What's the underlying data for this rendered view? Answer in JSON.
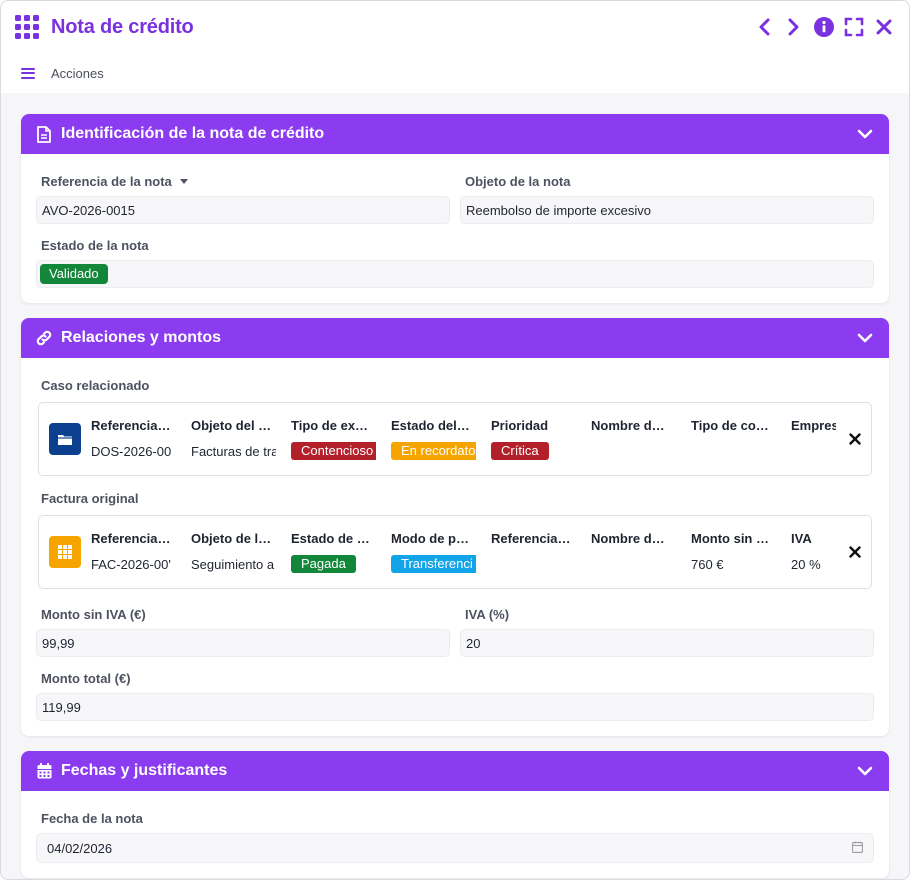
{
  "window": {
    "title": "Nota de crédito"
  },
  "actions": {
    "label": "Acciones"
  },
  "colors": {
    "accent": "#7a32e0",
    "header": "#8b3cf0",
    "green": "#12873a",
    "red": "#b4202a",
    "orange": "#f5a400",
    "blue": "#12a4e8",
    "navy": "#0d3f8f"
  },
  "section1": {
    "title": "Identificación de la nota de crédito",
    "ref_label": "Referencia de la nota",
    "ref_value": "AVO-2026-0015",
    "obj_label": "Objeto de la nota",
    "obj_value": "Reembolso de importe excesivo",
    "status_label": "Estado de la nota",
    "status_value": "Validado"
  },
  "section2": {
    "title": "Relaciones y montos",
    "case_label": "Caso relacionado",
    "case_headers": [
      "Referencia…",
      "Objeto del …",
      "Tipo de ex…",
      "Estado del…",
      "Prioridad",
      "Nombre d…",
      "Tipo de co…",
      "Empres"
    ],
    "case_values": [
      "DOS-2026-00",
      "Facturas de tra",
      "Contencioso",
      "En recordato",
      "Crítica",
      "",
      "",
      ""
    ],
    "invoice_label": "Factura original",
    "invoice_headers": [
      "Referencia…",
      "Objeto de l…",
      "Estado de …",
      "Modo de p…",
      "Referencia…",
      "Nombre d…",
      "Monto sin …",
      "IVA"
    ],
    "invoice_values": [
      "FAC-2026-00'",
      "Seguimiento a",
      "Pagada",
      "Transferenci",
      "",
      "",
      "760 €",
      "20 %"
    ],
    "amount_label": "Monto sin IVA (€)",
    "amount_value": "99,99",
    "vat_label": "IVA (%)",
    "vat_value": "20",
    "total_label": "Monto total (€)",
    "total_value": "119,99"
  },
  "section3": {
    "title": "Fechas y justificantes",
    "date_label": "Fecha de la nota",
    "date_value": "04/02/2026"
  },
  "icons": [
    "app-grid-icon",
    "chevron-left-icon",
    "chevron-right-icon",
    "info-icon",
    "fullscreen-icon",
    "close-icon",
    "menu-icon",
    "document-icon",
    "link-icon",
    "calendar-icon",
    "chevron-down-icon",
    "folder-icon",
    "table-icon",
    "remove-icon"
  ]
}
